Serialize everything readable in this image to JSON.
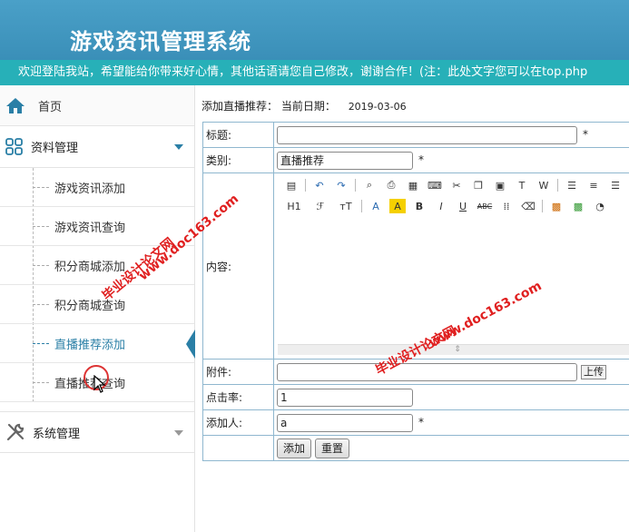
{
  "header": {
    "title": "游戏资讯管理系统"
  },
  "marquee": {
    "text": "欢迎登陆我站，希望能给你带来好心情，其他话语请您自己修改，谢谢合作！(注：此处文字您可以在top.php"
  },
  "sidebar": {
    "home": "首页",
    "group_data": "资料管理",
    "items": [
      "游戏资讯添加",
      "游戏资讯查询",
      "积分商城添加",
      "积分商城查询",
      "直播推荐添加",
      "直播推荐查询"
    ],
    "group_system": "系统管理"
  },
  "breadcrumb": {
    "label": "添加直播推荐：",
    "date_label": "当前日期：",
    "date": "2019-03-06"
  },
  "form": {
    "title_label": "标题:",
    "title_value": "",
    "category_label": "类别:",
    "category_value": "直播推荐",
    "content_label": "内容:",
    "attachment_label": "附件:",
    "upload_button": "上传",
    "clicks_label": "点击率:",
    "clicks_value": "1",
    "adder_label": "添加人:",
    "adder_value": "a",
    "required_mark": "*",
    "add_button": "添加",
    "reset_button": "重置"
  },
  "editor": {
    "heading_btn": "H1",
    "font_btn": "ℱ",
    "size_btn": "тT",
    "bold": "B",
    "italic": "I",
    "underline": "U",
    "strike": "ABC"
  },
  "watermark": {
    "line1": "毕业设计论文网",
    "line2": "www.doc163.com"
  },
  "colors": {
    "accent": "#2a7fa6",
    "header": "#3a8fb8",
    "marquee": "#27b0b8",
    "watermark": "#e02020"
  }
}
